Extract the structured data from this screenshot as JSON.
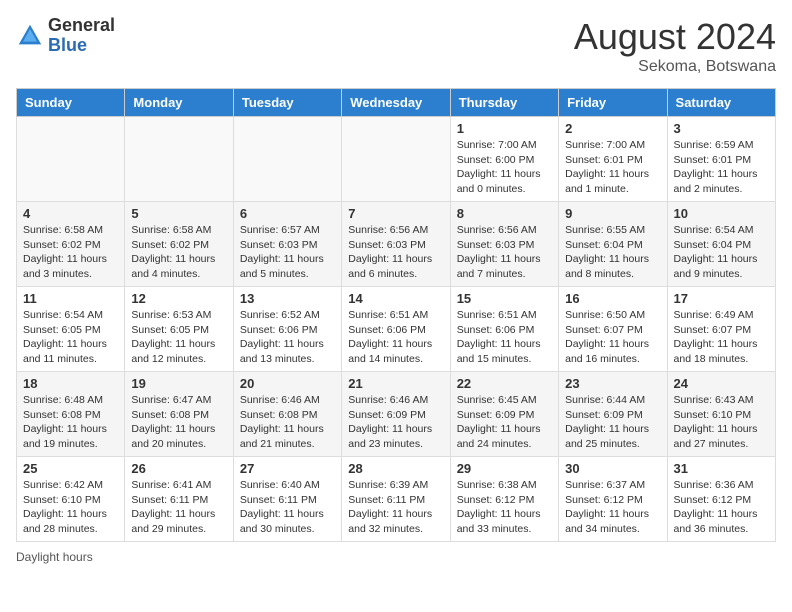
{
  "header": {
    "logo_general": "General",
    "logo_blue": "Blue",
    "month_title": "August 2024",
    "location": "Sekoma, Botswana"
  },
  "days_of_week": [
    "Sunday",
    "Monday",
    "Tuesday",
    "Wednesday",
    "Thursday",
    "Friday",
    "Saturday"
  ],
  "weeks": [
    [
      {
        "day": "",
        "empty": true
      },
      {
        "day": "",
        "empty": true
      },
      {
        "day": "",
        "empty": true
      },
      {
        "day": "",
        "empty": true
      },
      {
        "day": "1",
        "sunrise": "Sunrise: 7:00 AM",
        "sunset": "Sunset: 6:00 PM",
        "daylight": "Daylight: 11 hours and 0 minutes."
      },
      {
        "day": "2",
        "sunrise": "Sunrise: 7:00 AM",
        "sunset": "Sunset: 6:01 PM",
        "daylight": "Daylight: 11 hours and 1 minute."
      },
      {
        "day": "3",
        "sunrise": "Sunrise: 6:59 AM",
        "sunset": "Sunset: 6:01 PM",
        "daylight": "Daylight: 11 hours and 2 minutes."
      }
    ],
    [
      {
        "day": "4",
        "sunrise": "Sunrise: 6:58 AM",
        "sunset": "Sunset: 6:02 PM",
        "daylight": "Daylight: 11 hours and 3 minutes."
      },
      {
        "day": "5",
        "sunrise": "Sunrise: 6:58 AM",
        "sunset": "Sunset: 6:02 PM",
        "daylight": "Daylight: 11 hours and 4 minutes."
      },
      {
        "day": "6",
        "sunrise": "Sunrise: 6:57 AM",
        "sunset": "Sunset: 6:03 PM",
        "daylight": "Daylight: 11 hours and 5 minutes."
      },
      {
        "day": "7",
        "sunrise": "Sunrise: 6:56 AM",
        "sunset": "Sunset: 6:03 PM",
        "daylight": "Daylight: 11 hours and 6 minutes."
      },
      {
        "day": "8",
        "sunrise": "Sunrise: 6:56 AM",
        "sunset": "Sunset: 6:03 PM",
        "daylight": "Daylight: 11 hours and 7 minutes."
      },
      {
        "day": "9",
        "sunrise": "Sunrise: 6:55 AM",
        "sunset": "Sunset: 6:04 PM",
        "daylight": "Daylight: 11 hours and 8 minutes."
      },
      {
        "day": "10",
        "sunrise": "Sunrise: 6:54 AM",
        "sunset": "Sunset: 6:04 PM",
        "daylight": "Daylight: 11 hours and 9 minutes."
      }
    ],
    [
      {
        "day": "11",
        "sunrise": "Sunrise: 6:54 AM",
        "sunset": "Sunset: 6:05 PM",
        "daylight": "Daylight: 11 hours and 11 minutes."
      },
      {
        "day": "12",
        "sunrise": "Sunrise: 6:53 AM",
        "sunset": "Sunset: 6:05 PM",
        "daylight": "Daylight: 11 hours and 12 minutes."
      },
      {
        "day": "13",
        "sunrise": "Sunrise: 6:52 AM",
        "sunset": "Sunset: 6:06 PM",
        "daylight": "Daylight: 11 hours and 13 minutes."
      },
      {
        "day": "14",
        "sunrise": "Sunrise: 6:51 AM",
        "sunset": "Sunset: 6:06 PM",
        "daylight": "Daylight: 11 hours and 14 minutes."
      },
      {
        "day": "15",
        "sunrise": "Sunrise: 6:51 AM",
        "sunset": "Sunset: 6:06 PM",
        "daylight": "Daylight: 11 hours and 15 minutes."
      },
      {
        "day": "16",
        "sunrise": "Sunrise: 6:50 AM",
        "sunset": "Sunset: 6:07 PM",
        "daylight": "Daylight: 11 hours and 16 minutes."
      },
      {
        "day": "17",
        "sunrise": "Sunrise: 6:49 AM",
        "sunset": "Sunset: 6:07 PM",
        "daylight": "Daylight: 11 hours and 18 minutes."
      }
    ],
    [
      {
        "day": "18",
        "sunrise": "Sunrise: 6:48 AM",
        "sunset": "Sunset: 6:08 PM",
        "daylight": "Daylight: 11 hours and 19 minutes."
      },
      {
        "day": "19",
        "sunrise": "Sunrise: 6:47 AM",
        "sunset": "Sunset: 6:08 PM",
        "daylight": "Daylight: 11 hours and 20 minutes."
      },
      {
        "day": "20",
        "sunrise": "Sunrise: 6:46 AM",
        "sunset": "Sunset: 6:08 PM",
        "daylight": "Daylight: 11 hours and 21 minutes."
      },
      {
        "day": "21",
        "sunrise": "Sunrise: 6:46 AM",
        "sunset": "Sunset: 6:09 PM",
        "daylight": "Daylight: 11 hours and 23 minutes."
      },
      {
        "day": "22",
        "sunrise": "Sunrise: 6:45 AM",
        "sunset": "Sunset: 6:09 PM",
        "daylight": "Daylight: 11 hours and 24 minutes."
      },
      {
        "day": "23",
        "sunrise": "Sunrise: 6:44 AM",
        "sunset": "Sunset: 6:09 PM",
        "daylight": "Daylight: 11 hours and 25 minutes."
      },
      {
        "day": "24",
        "sunrise": "Sunrise: 6:43 AM",
        "sunset": "Sunset: 6:10 PM",
        "daylight": "Daylight: 11 hours and 27 minutes."
      }
    ],
    [
      {
        "day": "25",
        "sunrise": "Sunrise: 6:42 AM",
        "sunset": "Sunset: 6:10 PM",
        "daylight": "Daylight: 11 hours and 28 minutes."
      },
      {
        "day": "26",
        "sunrise": "Sunrise: 6:41 AM",
        "sunset": "Sunset: 6:11 PM",
        "daylight": "Daylight: 11 hours and 29 minutes."
      },
      {
        "day": "27",
        "sunrise": "Sunrise: 6:40 AM",
        "sunset": "Sunset: 6:11 PM",
        "daylight": "Daylight: 11 hours and 30 minutes."
      },
      {
        "day": "28",
        "sunrise": "Sunrise: 6:39 AM",
        "sunset": "Sunset: 6:11 PM",
        "daylight": "Daylight: 11 hours and 32 minutes."
      },
      {
        "day": "29",
        "sunrise": "Sunrise: 6:38 AM",
        "sunset": "Sunset: 6:12 PM",
        "daylight": "Daylight: 11 hours and 33 minutes."
      },
      {
        "day": "30",
        "sunrise": "Sunrise: 6:37 AM",
        "sunset": "Sunset: 6:12 PM",
        "daylight": "Daylight: 11 hours and 34 minutes."
      },
      {
        "day": "31",
        "sunrise": "Sunrise: 6:36 AM",
        "sunset": "Sunset: 6:12 PM",
        "daylight": "Daylight: 11 hours and 36 minutes."
      }
    ]
  ],
  "footer": {
    "daylight_label": "Daylight hours"
  }
}
